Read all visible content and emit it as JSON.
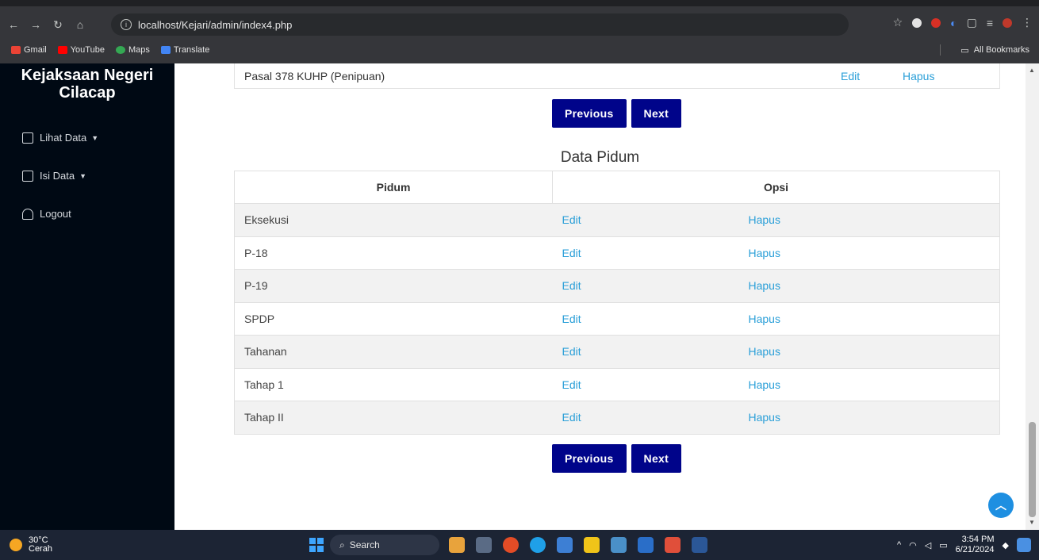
{
  "browser": {
    "url": "localhost/Kejari/admin/index4.php",
    "bookmarks": [
      "Gmail",
      "YouTube",
      "Maps",
      "Translate"
    ],
    "all_bookmarks": "All Bookmarks"
  },
  "sidebar": {
    "brand_line1": "Kejaksaan Negeri",
    "brand_line2": "Cilacap",
    "items": [
      {
        "label": "Lihat Data",
        "icon": "file-icon"
      },
      {
        "label": "Isi Data",
        "icon": "form-icon"
      },
      {
        "label": "Logout",
        "icon": "user-icon"
      }
    ]
  },
  "previous_table": {
    "last_row": {
      "name": "Pasal 378 KUHP (Penipuan)",
      "edit": "Edit",
      "delete": "Hapus"
    }
  },
  "pager": {
    "previous": "Previous",
    "next": "Next"
  },
  "pidum": {
    "title": "Data Pidum",
    "headers": [
      "Pidum",
      "Opsi"
    ],
    "rows": [
      {
        "name": "Eksekusi",
        "edit": "Edit",
        "delete": "Hapus"
      },
      {
        "name": "P-18",
        "edit": "Edit",
        "delete": "Hapus"
      },
      {
        "name": "P-19",
        "edit": "Edit",
        "delete": "Hapus"
      },
      {
        "name": "SPDP",
        "edit": "Edit",
        "delete": "Hapus"
      },
      {
        "name": "Tahanan",
        "edit": "Edit",
        "delete": "Hapus"
      },
      {
        "name": "Tahap 1",
        "edit": "Edit",
        "delete": "Hapus"
      },
      {
        "name": "Tahap II",
        "edit": "Edit",
        "delete": "Hapus"
      }
    ]
  },
  "taskbar": {
    "temp": "30°C",
    "weather": "Cerah",
    "search": "Search",
    "time": "3:54 PM",
    "date": "6/21/2024"
  },
  "colors": {
    "primary_button": "#00048a",
    "link": "#2a9fd8",
    "sidebar": "#000914"
  }
}
